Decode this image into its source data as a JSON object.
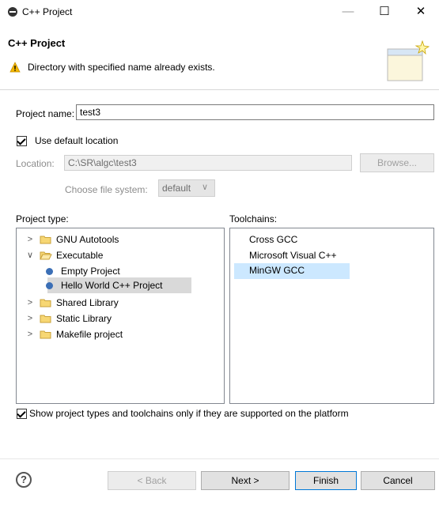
{
  "window": {
    "title": "C++ Project",
    "minimize": "—",
    "maximize": "☐",
    "close": "✕"
  },
  "header": {
    "title": "C++ Project",
    "message": "Directory with specified name already exists."
  },
  "project_name": {
    "label": "Project name:",
    "value": "test3"
  },
  "use_default_location": {
    "label": "Use default location",
    "checked": true
  },
  "location": {
    "label": "Location:",
    "value": "C:\\SR\\algc\\test3",
    "browse": "Browse..."
  },
  "file_system": {
    "label": "Choose file system:",
    "value": "default"
  },
  "project_type": {
    "label": "Project type:",
    "items": [
      {
        "label": "GNU Autotools",
        "chevron": ">"
      },
      {
        "label": "Executable",
        "chevron": "∨"
      },
      {
        "label": "Empty Project"
      },
      {
        "label": "Hello World C++ Project",
        "selected": true
      },
      {
        "label": "Shared Library",
        "chevron": ">"
      },
      {
        "label": "Static Library",
        "chevron": ">"
      },
      {
        "label": "Makefile project",
        "chevron": ">"
      }
    ]
  },
  "toolchains": {
    "label": "Toolchains:",
    "items": [
      {
        "label": "Cross GCC"
      },
      {
        "label": "Microsoft Visual C++"
      },
      {
        "label": "MinGW GCC",
        "selected": true
      }
    ]
  },
  "show_supported": {
    "label": "Show project types and toolchains only if they are supported on the platform",
    "checked": true
  },
  "buttons": {
    "help": "?",
    "back": "< Back",
    "next": "Next >",
    "finish": "Finish",
    "cancel": "Cancel"
  },
  "colors": {
    "selection": "#cce8ff",
    "tree_selection": "#d9d9d9",
    "accent": "#0078d7",
    "warning": "#f5b800"
  }
}
